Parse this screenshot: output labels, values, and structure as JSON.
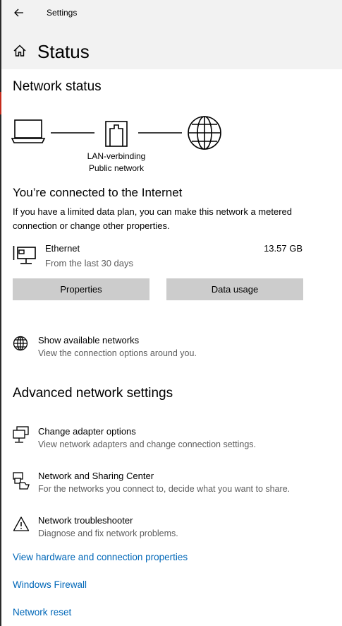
{
  "window": {
    "title": "Settings"
  },
  "page": {
    "title": "Status"
  },
  "network_status": {
    "heading": "Network status",
    "adapter_name": "LAN-verbinding",
    "network_type": "Public network",
    "connected_title": "You’re connected to the Internet",
    "connected_desc": "If you have a limited data plan, you can make this network a metered connection or change other properties."
  },
  "ethernet": {
    "name": "Ethernet",
    "period": "From the last 30 days",
    "usage": "13.57 GB",
    "properties_label": "Properties",
    "data_usage_label": "Data usage"
  },
  "available_networks": {
    "title": "Show available networks",
    "desc": "View the connection options around you."
  },
  "advanced": {
    "heading": "Advanced network settings",
    "items": [
      {
        "title": "Change adapter options",
        "desc": "View network adapters and change connection settings.",
        "icon": "adapter-icon"
      },
      {
        "title": "Network and Sharing Center",
        "desc": "For the networks you connect to, decide what you want to share.",
        "icon": "sharing-center-icon"
      },
      {
        "title": "Network troubleshooter",
        "desc": "Diagnose and fix network problems.",
        "icon": "warning-icon"
      }
    ]
  },
  "links": [
    "View hardware and connection properties",
    "Windows Firewall",
    "Network reset"
  ],
  "colors": {
    "link": "#0067b8",
    "button": "#cccccc",
    "header_bg": "#f2f2f2",
    "secondary_text": "#5d5d5d"
  }
}
